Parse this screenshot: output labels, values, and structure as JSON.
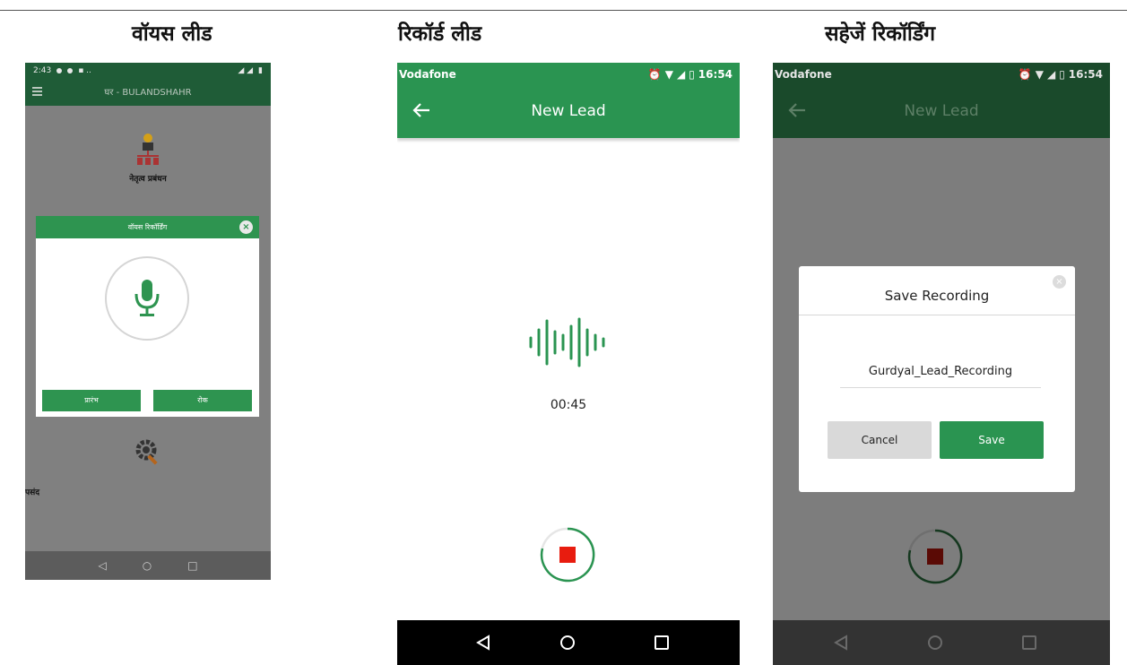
{
  "headings": {
    "voice_lead": "वॉयस लीड",
    "record_lead": "रिकॉर्ड लीड",
    "save_recording": "सहेजें रिकॉर्डिंग"
  },
  "phone1": {
    "status_time": "2:43",
    "app_title": "घर - BULANDSHAHR",
    "card_leadership_label": "नेतृत्व प्रबंधन",
    "card_preferences_label": "पसंद",
    "dialog": {
      "title": "वॉयस रिकॉर्डिंग",
      "start_label": "प्रारंभ",
      "stop_label": "रोक"
    }
  },
  "phone2": {
    "carrier": "Vodafone",
    "clock": "16:54",
    "title": "New Lead",
    "timer": "00:45"
  },
  "phone3": {
    "carrier": "Vodafone",
    "clock": "16:54",
    "title": "New Lead",
    "modal": {
      "title": "Save Recording",
      "filename": "Gurdyal_Lead_Recording",
      "cancel_label": "Cancel",
      "save_label": "Save"
    }
  },
  "colors": {
    "brand_green": "#2a9451",
    "dark_green": "#1f5c37",
    "stop_red": "#e81c0f"
  }
}
